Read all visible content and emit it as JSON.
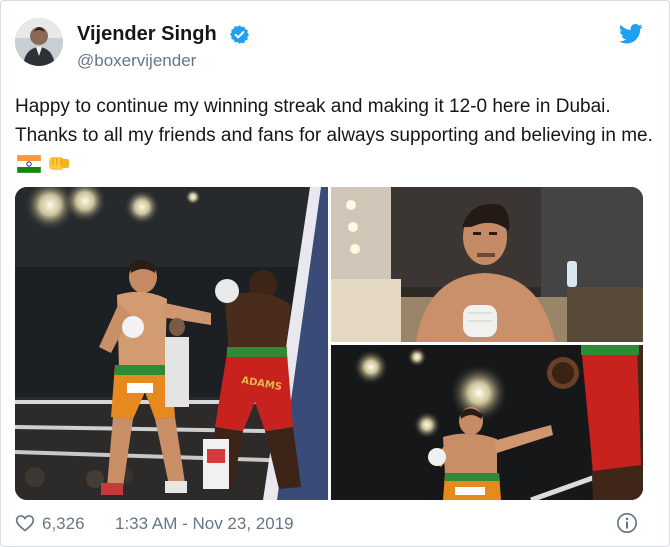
{
  "tweet": {
    "author_name": "Vijender Singh",
    "handle": "@boxervijender",
    "text": "Happy to continue my winning streak and making it 12-0 here in Dubai. Thanks to all my friends and fans for always supporting and believing in me.",
    "emojis": [
      "indian-flag-emoji",
      "fist-bump-emoji"
    ],
    "likes": "6,326",
    "timestamp": "1:33 AM - Nov 23, 2019",
    "photos": [
      {
        "caption": "boxing-match-photo",
        "trunk_text": "ADAMS"
      },
      {
        "caption": "dressing-room-portrait"
      },
      {
        "caption": "ring-action-photo"
      }
    ]
  },
  "colors": {
    "text": "#14171a",
    "secondary": "#657786",
    "twitter_blue": "#1da1f2",
    "border": "#d7dde2"
  },
  "icons": [
    "verified-badge-icon",
    "twitter-bird-icon",
    "heart-icon",
    "info-icon"
  ]
}
